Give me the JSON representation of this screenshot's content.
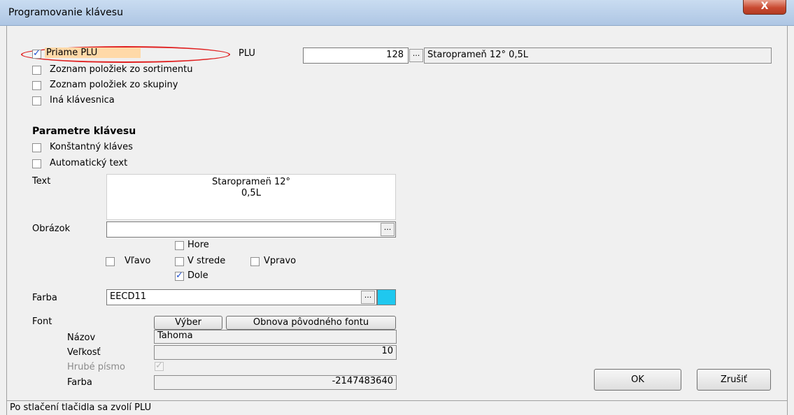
{
  "window": {
    "title": "Programovanie klávesu",
    "close_label": "X"
  },
  "key_type": {
    "options": [
      {
        "label": "Priame PLU",
        "checked": true
      },
      {
        "label": "Zoznam položiek zo sortimentu",
        "checked": false
      },
      {
        "label": "Zoznam položiek zo skupiny",
        "checked": false
      },
      {
        "label": "Iná klávesnica",
        "checked": false
      }
    ]
  },
  "plu": {
    "label": "PLU",
    "number": "128",
    "ellipsis": "...",
    "name": "Staroprameň 12° 0,5L"
  },
  "params": {
    "heading": "Parametre klávesu",
    "constant_key": {
      "label": "Konštantný kláves",
      "checked": false
    },
    "auto_text": {
      "label": "Automatický text",
      "checked": false
    },
    "text_label": "Text",
    "text_line1": "Staropramen̈ 12°",
    "text_line2": "0,5L",
    "image_label": "Obrázok",
    "image_value": "",
    "image_ellipsis": "...",
    "align_top": {
      "label": "Hore",
      "checked": false
    },
    "align_left": {
      "label": "Vľavo",
      "checked": false
    },
    "align_center": {
      "label": "V strede",
      "checked": false
    },
    "align_right": {
      "label": "Vpravo",
      "checked": false
    },
    "align_bottom": {
      "label": "Dole",
      "checked": true
    },
    "color_label": "Farba",
    "color_value": "EECD11",
    "color_ellipsis": "...",
    "color_swatch": "#1fc8ef"
  },
  "font": {
    "label": "Font",
    "choose_button": "Výber",
    "restore_button": "Obnova pôvodného fontu",
    "name_label": "Názov",
    "name_value": "Tahoma",
    "size_label": "Veľkosť",
    "size_value": "10",
    "bold_label": "Hrubé písmo",
    "bold_checked": true,
    "color_label": "Farba",
    "color_value": "-2147483640"
  },
  "buttons": {
    "ok": "OK",
    "cancel": "Zrušiť"
  },
  "status_text": "Po stlačení tlačidla sa zvolí PLU"
}
